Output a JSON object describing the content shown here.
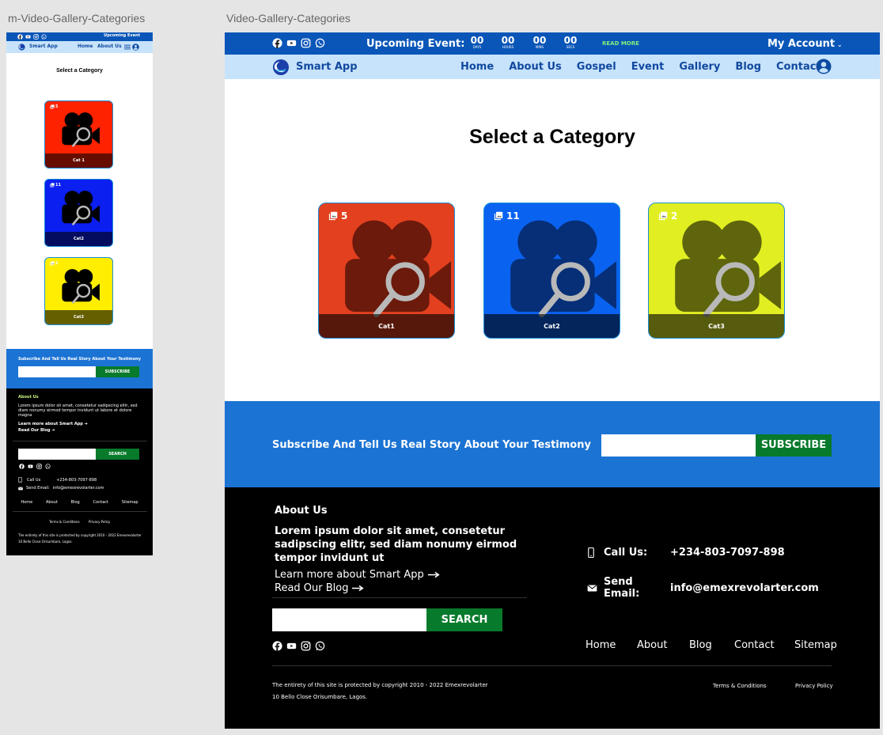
{
  "artboards": {
    "mobile_label": "m-Video-Gallery-Categories",
    "desktop_label": "Video-Gallery-Categories"
  },
  "colors": {
    "topbar": "#0a56b8",
    "navbar": "#c7e3fb",
    "subscribe_bg": "#1b73d4",
    "green_button": "#087a2c",
    "cat1": "#e2401f",
    "cat2": "#0a62f0",
    "cat3": "#e1ef22"
  },
  "social_icons": [
    "facebook-icon",
    "youtube-icon",
    "instagram-icon",
    "whatsapp-icon"
  ],
  "topbar": {
    "upcoming": "Upcoming Event:",
    "upcoming_mobile": "Upcoming Event",
    "countdown": [
      {
        "value": "00",
        "unit": "DAYS"
      },
      {
        "value": "00",
        "unit": "HOURS"
      },
      {
        "value": "00",
        "unit": "MINS"
      },
      {
        "value": "00",
        "unit": "SECS"
      }
    ],
    "read_more": "READ MORE",
    "account": "My Account"
  },
  "nav": {
    "brand": "Smart App",
    "links": [
      "Home",
      "About Us",
      "Gospel",
      "Event",
      "Gallery",
      "Blog",
      "Contact"
    ],
    "mobile_links": [
      "Home",
      "About Us"
    ]
  },
  "page": {
    "title": "Select a Category"
  },
  "categories": [
    {
      "label": "Cat1",
      "mobile_label": "Cat 1",
      "count": "5"
    },
    {
      "label": "Cat2",
      "mobile_label": "Cat2",
      "count": "11"
    },
    {
      "label": "Cat3",
      "mobile_label": "Cat3",
      "count": "2"
    }
  ],
  "subscribe": {
    "text": "Subscribe And Tell Us Real Story About Your Testimony",
    "button": "SUBSCRIBE",
    "input_value": ""
  },
  "footer": {
    "about_title": "About Us",
    "about_text": "Lorem ipsum dolor sit amet, consetetur sadipscing elitr, sed diam nonumy eirmod tempor invidunt ut",
    "about_text_mobile": "Lorem ipsum dolor sit amet, consetetur sadipscing elitr, sed diam nonumy eirmod tempor invidunt ut labore et dolore magna",
    "learn_more": "Learn more about Smart App",
    "read_blog": "Read Our Blog",
    "search_button": "SEARCH",
    "search_value": "",
    "call_label": "Call Us:",
    "call_label_mobile": "Call Us",
    "phone": "+234-803-7097-898",
    "email_label": "Send Email:",
    "email": "info@emexrevolarter.com",
    "links": [
      "Home",
      "About",
      "Blog",
      "Contact",
      "Sitemap"
    ],
    "copyright": "The entirety of this site is protected by copyright  2010 - 2022 Emexrevolarter",
    "address": "10 Bello Close Orisumbare, Lagos.",
    "copyright_mobile": "The entirety of this site is protected by copyright  2010 - 2022 Emexrevolarter 10 Bello Close Orisumbare, Lagos.",
    "terms": "Terms & Conditions",
    "privacy": "Privacy Policy"
  }
}
